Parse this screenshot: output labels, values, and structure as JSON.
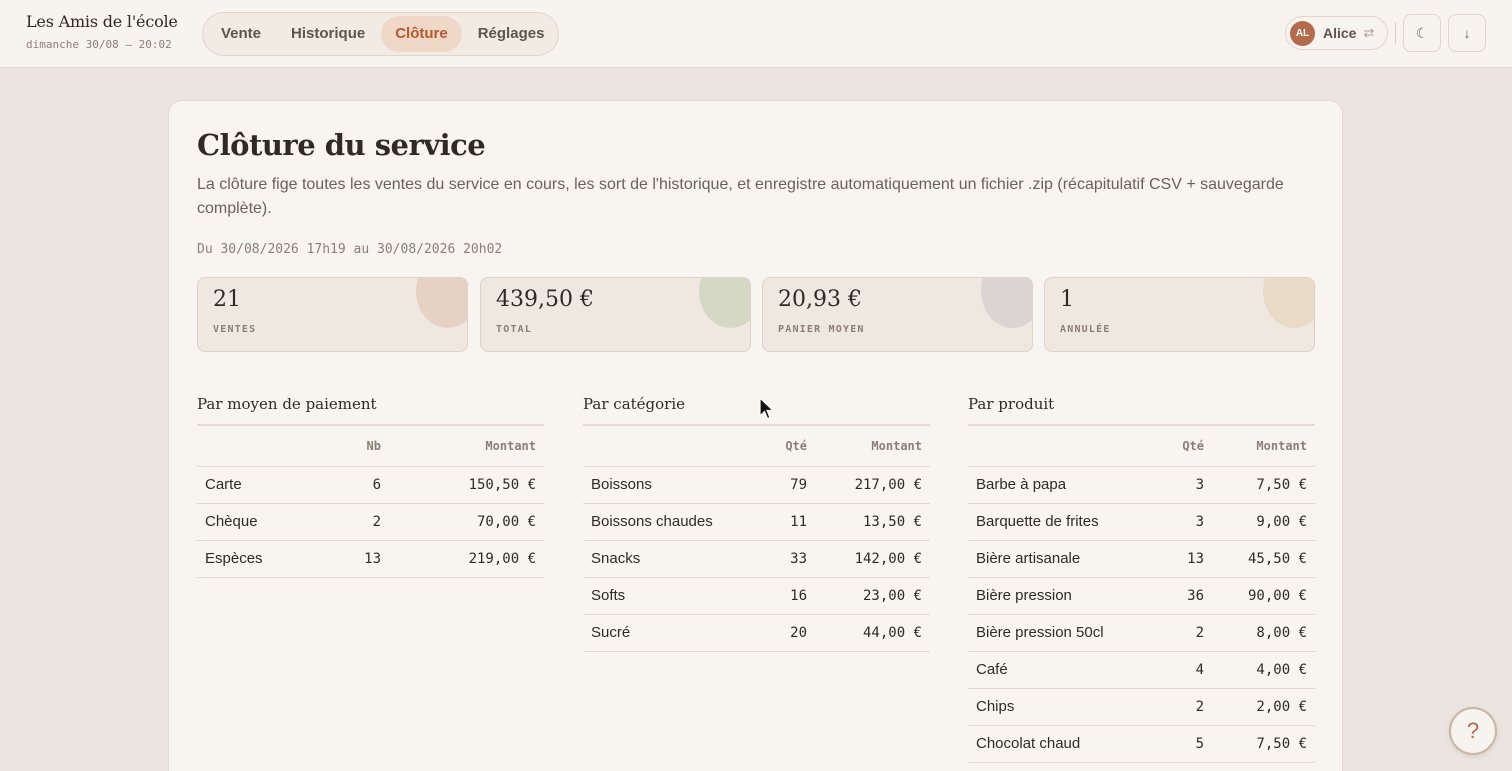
{
  "header": {
    "brand_name": "Les Amis de l'école",
    "datetime": "dimanche 30/08 — 20:02",
    "tabs": [
      {
        "label": "Vente"
      },
      {
        "label": "Historique"
      },
      {
        "label": "Clôture"
      },
      {
        "label": "Réglages"
      }
    ],
    "active_tab": "Clôture",
    "user": {
      "initials": "AL",
      "name": "Alice",
      "swap_icon": "swap-icon"
    },
    "theme_icon": "moon-icon",
    "download_icon": "download-icon"
  },
  "main": {
    "title": "Clôture du service",
    "description": "La clôture fige toutes les ventes du service en cours, les sort de l'historique, et enregistre automatiquement un fichier .zip (récapitulatif CSV + sauvegarde complète).",
    "range": "Du 30/08/2026 17h19 au 30/08/2026 20h02",
    "stats": [
      {
        "value": "21",
        "label": "VENTES",
        "accent": "#e6d2c4"
      },
      {
        "value": "439,50 €",
        "label": "TOTAL",
        "accent": "#d6d8c6"
      },
      {
        "value": "20,93 €",
        "label": "PANIER MOYEN",
        "accent": "#dcd4d2"
      },
      {
        "value": "1",
        "label": "ANNULÉE",
        "accent": "#eadbc9"
      }
    ],
    "payment": {
      "title": "Par moyen de paiement",
      "headers": [
        "",
        "Nb",
        "Montant"
      ],
      "rows": [
        [
          "Carte",
          "6",
          "150,50 €"
        ],
        [
          "Chèque",
          "2",
          "70,00 €"
        ],
        [
          "Espèces",
          "13",
          "219,00 €"
        ]
      ]
    },
    "category": {
      "title": "Par catégorie",
      "headers": [
        "",
        "Qté",
        "Montant"
      ],
      "rows": [
        [
          "Boissons",
          "79",
          "217,00 €"
        ],
        [
          "Boissons chaudes",
          "11",
          "13,50 €"
        ],
        [
          "Snacks",
          "33",
          "142,00 €"
        ],
        [
          "Softs",
          "16",
          "23,00 €"
        ],
        [
          "Sucré",
          "20",
          "44,00 €"
        ]
      ]
    },
    "product": {
      "title": "Par produit",
      "headers": [
        "",
        "Qté",
        "Montant"
      ],
      "rows": [
        [
          "Barbe à papa",
          "3",
          "7,50 €"
        ],
        [
          "Barquette de frites",
          "3",
          "9,00 €"
        ],
        [
          "Bière artisanale",
          "13",
          "45,50 €"
        ],
        [
          "Bière pression",
          "36",
          "90,00 €"
        ],
        [
          "Bière pression 50cl",
          "2",
          "8,00 €"
        ],
        [
          "Café",
          "4",
          "4,00 €"
        ],
        [
          "Chips",
          "2",
          "2,00 €"
        ],
        [
          "Chocolat chaud",
          "5",
          "7,50 €"
        ]
      ]
    }
  },
  "help": {
    "label": "?"
  },
  "colors": {
    "accent": "#b5592f",
    "background": "#ece4de",
    "card": "#f8f5f1"
  }
}
